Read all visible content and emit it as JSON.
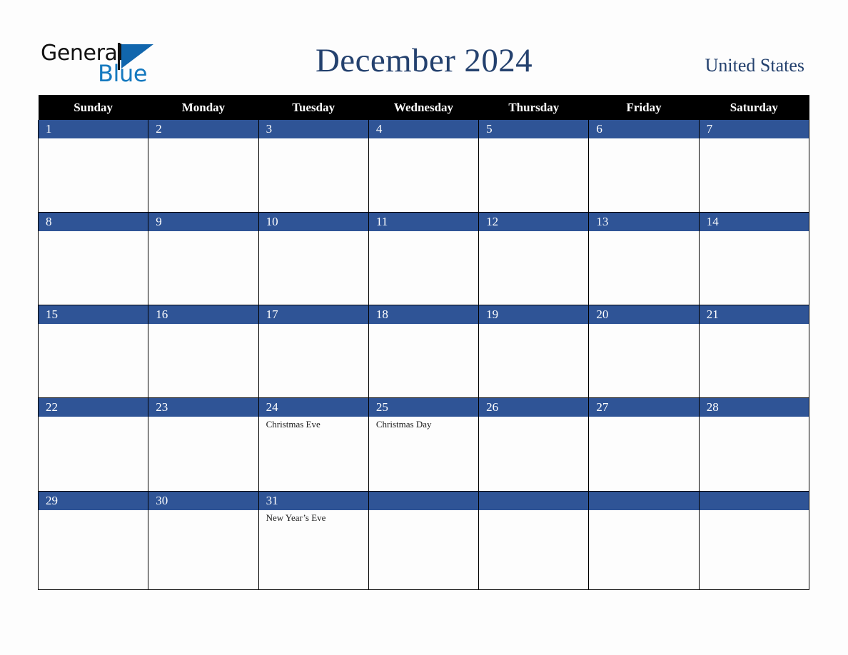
{
  "brand": {
    "name_part1": "General",
    "name_part2": "Blue",
    "triangle_color": "#1166ad",
    "blue_text_color": "#1579bf"
  },
  "header": {
    "title": "December 2024",
    "country": "United States",
    "title_color": "#24416e"
  },
  "calendar": {
    "month": "December",
    "year": "2024",
    "weekday_headers": [
      "Sunday",
      "Monday",
      "Tuesday",
      "Wednesday",
      "Thursday",
      "Friday",
      "Saturday"
    ],
    "header_bg": "#000000",
    "daynum_bg": "#2f5496",
    "weeks": [
      {
        "days": [
          {
            "num": "1",
            "events": []
          },
          {
            "num": "2",
            "events": []
          },
          {
            "num": "3",
            "events": []
          },
          {
            "num": "4",
            "events": []
          },
          {
            "num": "5",
            "events": []
          },
          {
            "num": "6",
            "events": []
          },
          {
            "num": "7",
            "events": []
          }
        ]
      },
      {
        "days": [
          {
            "num": "8",
            "events": []
          },
          {
            "num": "9",
            "events": []
          },
          {
            "num": "10",
            "events": []
          },
          {
            "num": "11",
            "events": []
          },
          {
            "num": "12",
            "events": []
          },
          {
            "num": "13",
            "events": []
          },
          {
            "num": "14",
            "events": []
          }
        ]
      },
      {
        "days": [
          {
            "num": "15",
            "events": []
          },
          {
            "num": "16",
            "events": []
          },
          {
            "num": "17",
            "events": []
          },
          {
            "num": "18",
            "events": []
          },
          {
            "num": "19",
            "events": []
          },
          {
            "num": "20",
            "events": []
          },
          {
            "num": "21",
            "events": []
          }
        ]
      },
      {
        "days": [
          {
            "num": "22",
            "events": []
          },
          {
            "num": "23",
            "events": []
          },
          {
            "num": "24",
            "events": [
              "Christmas Eve"
            ]
          },
          {
            "num": "25",
            "events": [
              "Christmas Day"
            ]
          },
          {
            "num": "26",
            "events": []
          },
          {
            "num": "27",
            "events": []
          },
          {
            "num": "28",
            "events": []
          }
        ]
      },
      {
        "days": [
          {
            "num": "29",
            "events": []
          },
          {
            "num": "30",
            "events": []
          },
          {
            "num": "31",
            "events": [
              "New Year’s Eve"
            ]
          },
          {
            "num": "",
            "events": []
          },
          {
            "num": "",
            "events": []
          },
          {
            "num": "",
            "events": []
          },
          {
            "num": "",
            "events": []
          }
        ]
      }
    ]
  }
}
